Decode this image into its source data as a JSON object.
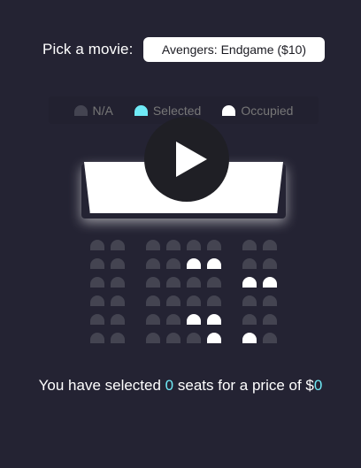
{
  "picker": {
    "label": "Pick a movie:",
    "selected_movie": "Avengers: Endgame ($10)"
  },
  "legend": [
    {
      "label": "N/A",
      "status": "na"
    },
    {
      "label": "Selected",
      "status": "selected"
    },
    {
      "label": "Occupied",
      "status": "occupied"
    }
  ],
  "colors": {
    "background": "#242333",
    "seat_available": "#444451",
    "seat_selected": "#6feaf6",
    "seat_occupied": "#ffffff"
  },
  "video": {
    "icon": "play-icon"
  },
  "seating": {
    "rows": [
      [
        "a",
        "a",
        "a",
        "a",
        "a",
        "a",
        "a",
        "a",
        "a",
        "a"
      ],
      [
        "a",
        "a",
        "a",
        "a",
        "o",
        "o",
        "a",
        "a",
        "a",
        "a"
      ],
      [
        "a",
        "a",
        "a",
        "a",
        "a",
        "a",
        "a",
        "a",
        "o",
        "o"
      ],
      [
        "a",
        "a",
        "a",
        "a",
        "a",
        "a",
        "a",
        "a",
        "a",
        "a"
      ],
      [
        "a",
        "a",
        "a",
        "a",
        "o",
        "o",
        "a",
        "a",
        "a",
        "a"
      ],
      [
        "a",
        "a",
        "a",
        "a",
        "a",
        "o",
        "o",
        "a",
        "o",
        "a"
      ]
    ]
  },
  "summary": {
    "prefix": "You have selected ",
    "count": "0",
    "middle": " seats for a price of $",
    "total": "0"
  }
}
